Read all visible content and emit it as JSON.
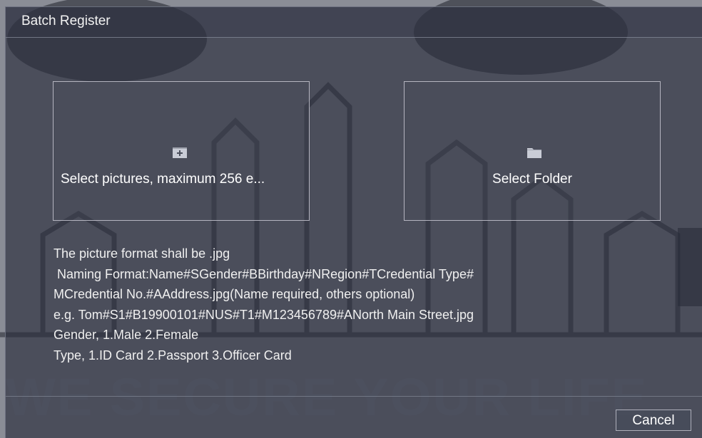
{
  "background": {
    "watermark_text": "WE SECURE YOUR LIFE"
  },
  "dialog": {
    "title": "Batch Register",
    "select_pictures": {
      "icon": "add-picture-icon",
      "label": "Select pictures, maximum 256 e..."
    },
    "select_folder": {
      "icon": "folder-icon",
      "label": "Select Folder"
    },
    "info_lines": [
      "The picture format shall be .jpg",
      " Naming Format:Name#SGender#BBirthday#NRegion#TCredential Type#",
      "MCredential No.#AAddress.jpg(Name required, others optional)",
      "e.g. Tom#S1#B19900101#NUS#T1#M123456789#ANorth Main Street.jpg",
      "Gender, 1.Male 2.Female",
      "Type, 1.ID Card 2.Passport 3.Officer Card"
    ],
    "cancel_label": "Cancel"
  },
  "colors": {
    "overlay": "#2a2d3c",
    "background": "#8a8d96",
    "text": "#ffffff"
  }
}
